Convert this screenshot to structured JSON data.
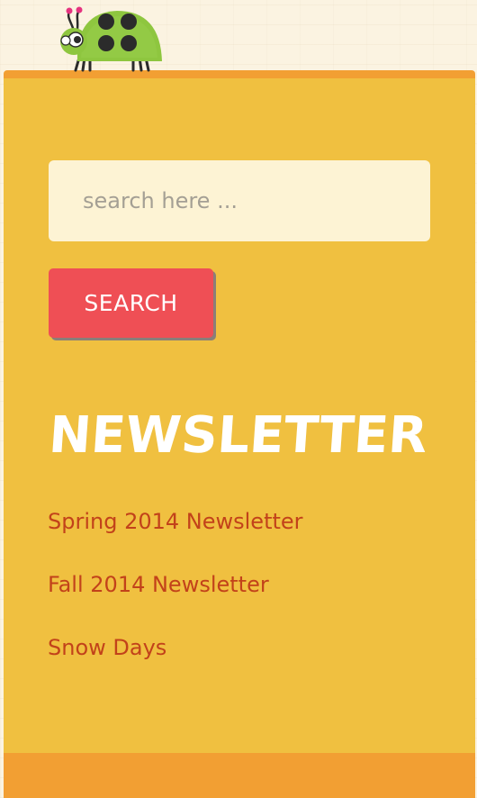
{
  "search": {
    "placeholder": "search here ...",
    "value": "",
    "button_label": "SEARCH"
  },
  "newsletter": {
    "title": "NEWSLETTER",
    "links": [
      "Spring 2014 Newsletter",
      "Fall 2014 Newsletter",
      "Snow Days"
    ]
  },
  "mascot": {
    "icon": "ladybug-icon",
    "body_color": "#8ec63f",
    "spot_color": "#2b2b2b"
  },
  "colors": {
    "panel": "#f0c040",
    "panel_border": "#f29f33",
    "search_field": "#fdf3d4",
    "search_button": "#ef4f55",
    "link": "#c2421a",
    "title": "#ffffff"
  }
}
